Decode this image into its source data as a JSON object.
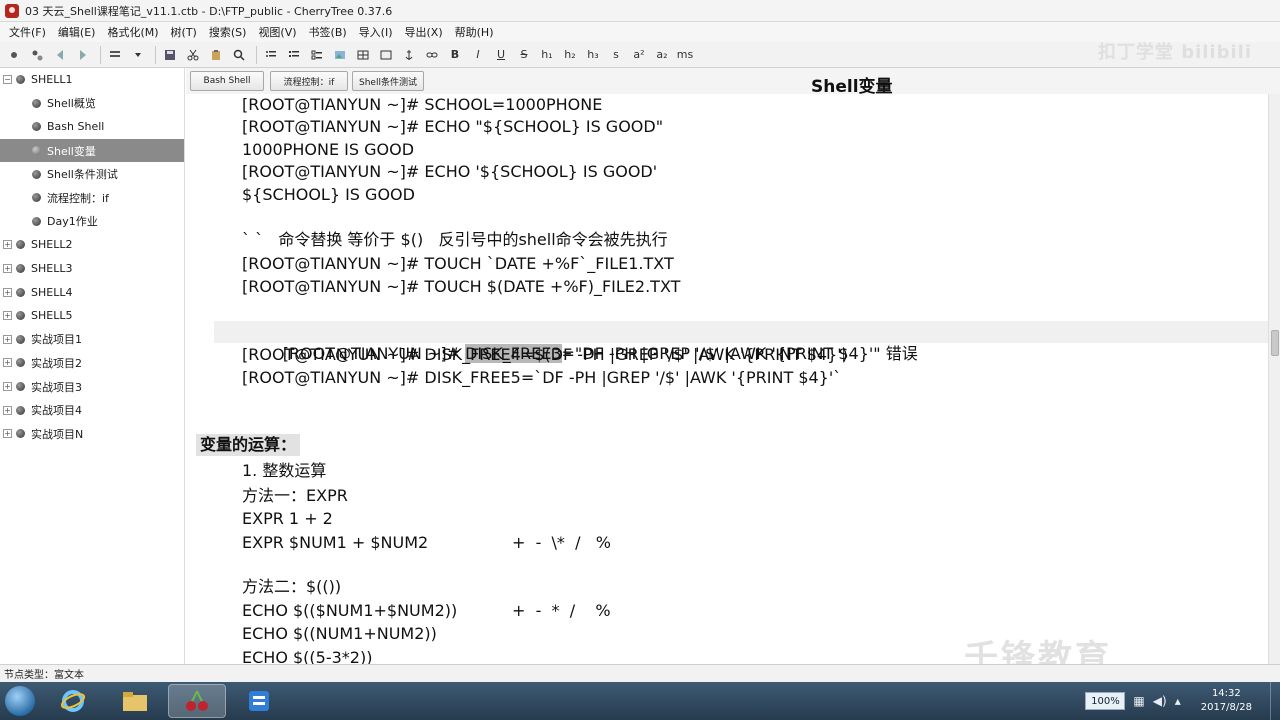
{
  "window": {
    "title": "03 天云_Shell课程笔记_v11.1.ctb - D:\\FTP_public - CherryTree 0.37.6"
  },
  "menu": [
    "文件(F)",
    "编辑(E)",
    "格式化(M)",
    "树(T)",
    "搜索(S)",
    "视图(V)",
    "书签(B)",
    "导入(I)",
    "导出(X)",
    "帮助(H)"
  ],
  "toolbar": {
    "h1": "h₁",
    "h2": "h₂",
    "h3": "h₃",
    "small": "s",
    "sup": "a²",
    "sub": "a₂",
    "mono": "ms"
  },
  "watermark_top": "扣丁学堂 bilibili",
  "tree": {
    "shell1": "SHELL1",
    "children": [
      "Shell概览",
      "Bash Shell",
      "Shell变量",
      "Shell条件测试",
      "流程控制：if",
      "Day1作业"
    ],
    "nodes": [
      "SHELL2",
      "SHELL3",
      "SHELL4",
      "SHELL5",
      "实战项目1",
      "实战项目2",
      "实战项目3",
      "实战项目4",
      "实战项目N"
    ]
  },
  "tabs": [
    "Bash Shell",
    "流程控制：if",
    "Shell条件测试"
  ],
  "node_title": "Shell变量",
  "lines": {
    "l1": "[ROOT@TIANYUN ~]# SCHOOL=1000PHONE",
    "l2": "[ROOT@TIANYUN ~]# ECHO \"${SCHOOL} IS GOOD\"",
    "l3": "1000PHONE IS GOOD",
    "l4": "[ROOT@TIANYUN ~]# ECHO '${SCHOOL} IS GOOD'",
    "l5": "${SCHOOL} IS GOOD",
    "l6": "` `   命令替换 等价于 $()   反引号中的shell命令会被先执行",
    "l7": "[ROOT@TIANYUN ~]# TOUCH `DATE +%F`_FILE1.TXT",
    "l8": "[ROOT@TIANYUN ~]# TOUCH $(DATE +%F)_FILE2.TXT",
    "l9_prefix": "[ROOT@TIANYUN ~]# ",
    "l9_sel": "DISK_FREE3",
    "l9_rest": "=\"DF -PH |GREP '/$' |AWK '{PRINT $4}'\" 错误",
    "l10": "[ROOT@TIANYUN ~]# DISK_FREE4=$(DF -PH |GREP '/$' |AWK '{PRINT $4}')",
    "l11": "[ROOT@TIANYUN ~]# DISK_FREE5=`DF -PH |GREP '/$' |AWK '{PRINT $4}'`",
    "heading": "变量的运算：",
    "l12": "1. 整数运算",
    "l13": "方法一：EXPR",
    "l14": "EXPR 1 + 2",
    "l15": "EXPR $NUM1 + $NUM2",
    "l15_ops": "+  -  \\*  /   %",
    "l16": "方法二：$(())",
    "l17": "ECHO $(($NUM1+$NUM2))",
    "l17_ops": "+  -  *  /    %",
    "l18": "ECHO $((NUM1+NUM2))",
    "l19": "ECHO $((5-3*2))"
  },
  "watermark_bottom": "千锋教育",
  "statusbar": "节点类型：富文本",
  "taskbar": {
    "zoom": "100%",
    "time": "14:32",
    "date": "2017/8/28"
  }
}
